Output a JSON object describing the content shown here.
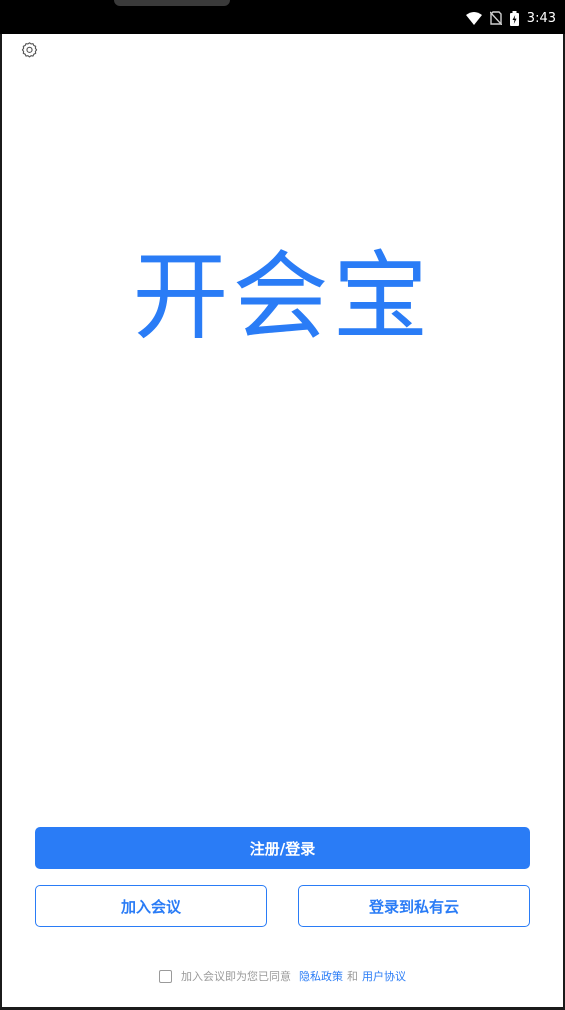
{
  "status_bar": {
    "time": "3:43",
    "icons": [
      "wifi-icon",
      "no-sim-icon",
      "battery-charging-icon"
    ]
  },
  "header": {
    "settings_icon": "gear-icon"
  },
  "brand": {
    "logo_text": "开会宝",
    "accent_color": "#2a7cf6"
  },
  "actions": {
    "register_login": "注册/登录",
    "join_meeting": "加入会议",
    "private_cloud_login": "登录到私有云"
  },
  "agreement": {
    "checked": false,
    "prefix": "加入会议即为您已同意",
    "privacy_policy": "隐私政策",
    "conjunction": "和",
    "user_agreement": "用户协议"
  }
}
